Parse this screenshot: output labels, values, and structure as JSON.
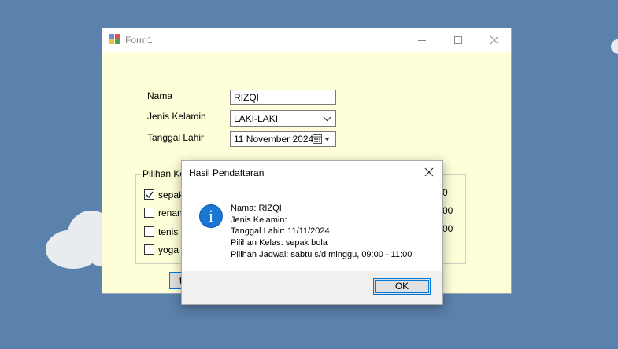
{
  "form": {
    "title": "Form1",
    "labels": {
      "nama": "Nama",
      "jenis_kelamin": "Jenis Kelamin",
      "tanggal_lahir": "Tanggal Lahir"
    },
    "nama_value": "RIZQI",
    "jenis_kelamin_value": "LAKI-LAKI",
    "tanggal_lahir_value": "11 November 2024",
    "group_title": "Pilihan Kela",
    "classes": [
      {
        "label": "sepak",
        "checked": true
      },
      {
        "label": "renang",
        "checked": false
      },
      {
        "label": "tenis",
        "checked": false
      },
      {
        "label": "yoga",
        "checked": false
      }
    ],
    "peek_text": [
      "0",
      "00",
      "00"
    ],
    "hidden_button_label": "t"
  },
  "dialog": {
    "title": "Hasil Pendaftaran",
    "lines": [
      "Nama: RIZQI",
      "Jenis Kelamin:",
      "Tanggal Lahir: 11/11/2024",
      "Pilihan Kelas: sepak bola",
      "Pilihan Jadwal: sabtu s/d minggu, 09:00 - 11:00"
    ],
    "ok_label": "OK",
    "icon": "information-icon"
  },
  "colors": {
    "desktop": "#5b81ad",
    "form_background": "#fefed9",
    "accent": "#0078d7",
    "info_icon": "#1976d2"
  }
}
